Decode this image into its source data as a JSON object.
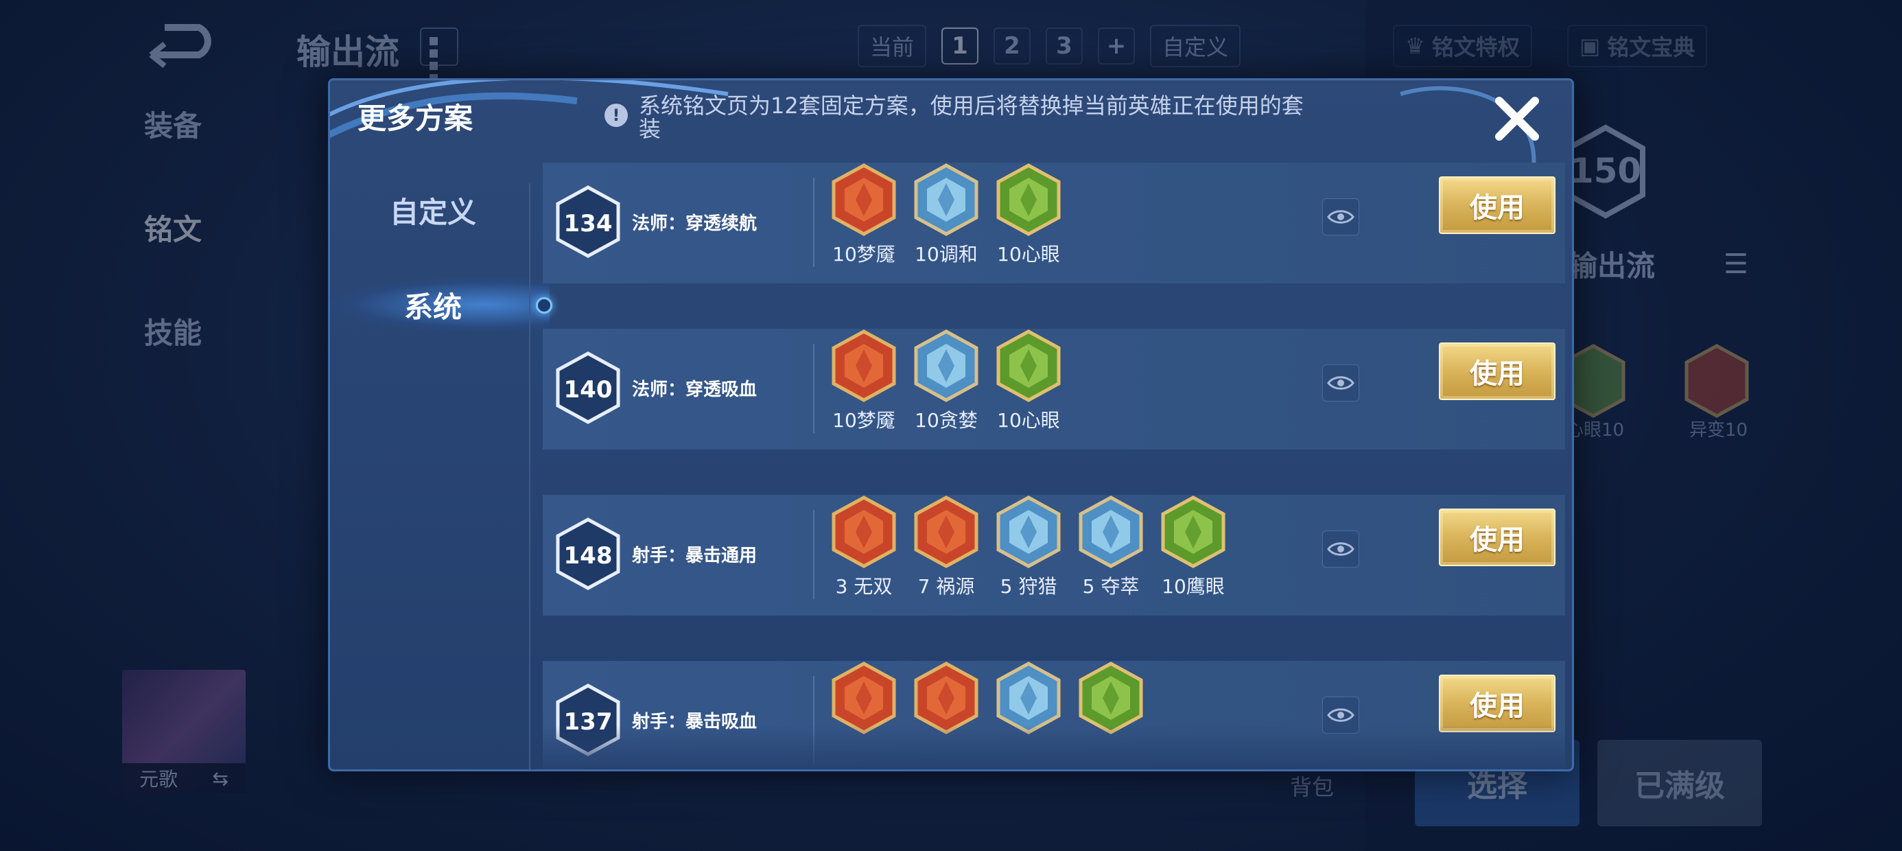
{
  "background": {
    "title": "输出流",
    "page_bar": {
      "current_label": "当前",
      "pages": [
        "1",
        "2",
        "3",
        "+"
      ],
      "active_page": "1",
      "custom_label": "自定义"
    },
    "links": {
      "privilege": "铭文特权",
      "codex": "铭文宝典"
    },
    "side_nav": [
      "装备",
      "铭文",
      "技能"
    ],
    "hero_level": "150",
    "plan_name": "输出流",
    "runes": [
      {
        "label": "心眼10"
      },
      {
        "label": "异变10"
      }
    ],
    "hero_name": "元歌",
    "backpack_label": "背包",
    "buttons": {
      "select": "选择",
      "maxed": "已满级"
    }
  },
  "modal": {
    "title": "更多方案",
    "notice": "系统铭文页为12套固定方案，使用后将替换掉当前英雄正在使用的套装",
    "tabs": [
      {
        "label": "自定义",
        "active": false
      },
      {
        "label": "系统",
        "active": true
      }
    ],
    "use_label": "使用",
    "plans": [
      {
        "level": "134",
        "name": "法师：穿透续航",
        "runes": [
          {
            "label": "10梦魇",
            "color": "red",
            "icon": "rune-dream"
          },
          {
            "label": "10调和",
            "color": "blue",
            "icon": "rune-harmony"
          },
          {
            "label": "10心眼",
            "color": "green",
            "icon": "rune-mind-eye"
          }
        ]
      },
      {
        "level": "140",
        "name": "法师：穿透吸血",
        "runes": [
          {
            "label": "10梦魇",
            "color": "red",
            "icon": "rune-dream"
          },
          {
            "label": "10贪婪",
            "color": "blue",
            "icon": "rune-greed"
          },
          {
            "label": "10心眼",
            "color": "green",
            "icon": "rune-mind-eye"
          }
        ]
      },
      {
        "level": "148",
        "name": "射手：暴击通用",
        "runes": [
          {
            "label": "3 无双",
            "color": "red",
            "icon": "rune-peerless"
          },
          {
            "label": "7 祸源",
            "color": "red",
            "icon": "rune-calamity"
          },
          {
            "label": "5 狩猎",
            "color": "blue",
            "icon": "rune-hunt"
          },
          {
            "label": "5 夺萃",
            "color": "blue",
            "icon": "rune-plunder"
          },
          {
            "label": "10鹰眼",
            "color": "green",
            "icon": "rune-hawk-eye"
          }
        ]
      },
      {
        "level": "137",
        "name": "射手：暴击吸血",
        "runes": [
          {
            "label": "",
            "color": "red",
            "icon": "rune-peerless"
          },
          {
            "label": "",
            "color": "red",
            "icon": "rune-calamity"
          },
          {
            "label": "",
            "color": "blue",
            "icon": "rune-plunder"
          },
          {
            "label": "",
            "color": "green",
            "icon": "rune-hawk-eye"
          }
        ]
      }
    ]
  },
  "colors": {
    "red": "#d2512a",
    "blue": "#6fb4e0",
    "green": "#7fb23c",
    "gold": "#d9b45a"
  }
}
